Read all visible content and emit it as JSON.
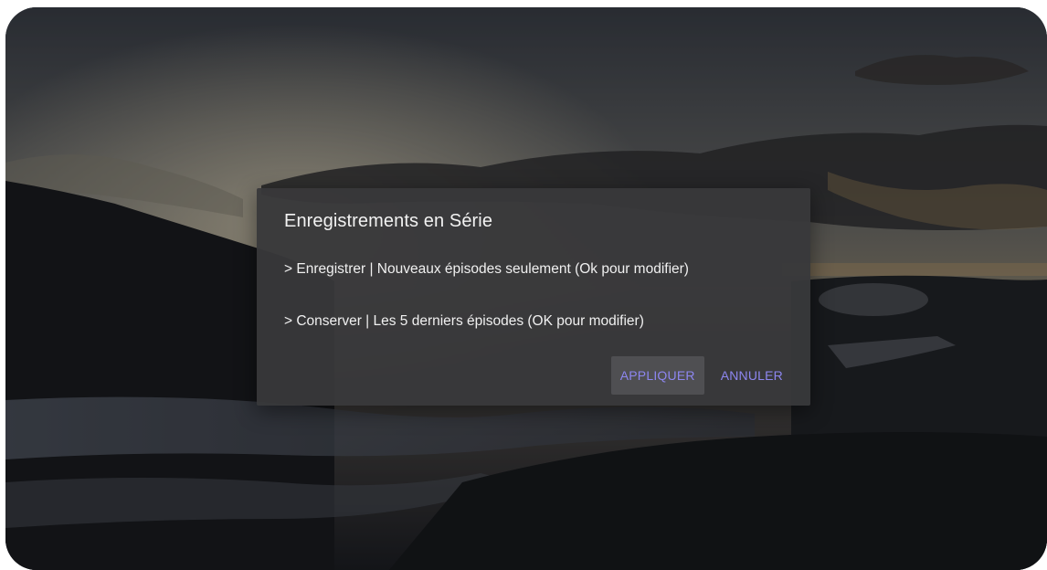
{
  "dialog": {
    "title": "Enregistrements en Série",
    "options": [
      "> Enregistrer | Nouveaux épisodes seulement (Ok pour modifier)",
      "> Conserver | Les 5 derniers épisodes (OK pour modifier)"
    ],
    "apply_label": "APPLIQUER",
    "cancel_label": "ANNULER"
  },
  "colors": {
    "dialog_bg": "#38383a",
    "accent": "#8d86f0",
    "focused_button_bg": "#4f4f52",
    "text": "#f0f0f0"
  }
}
